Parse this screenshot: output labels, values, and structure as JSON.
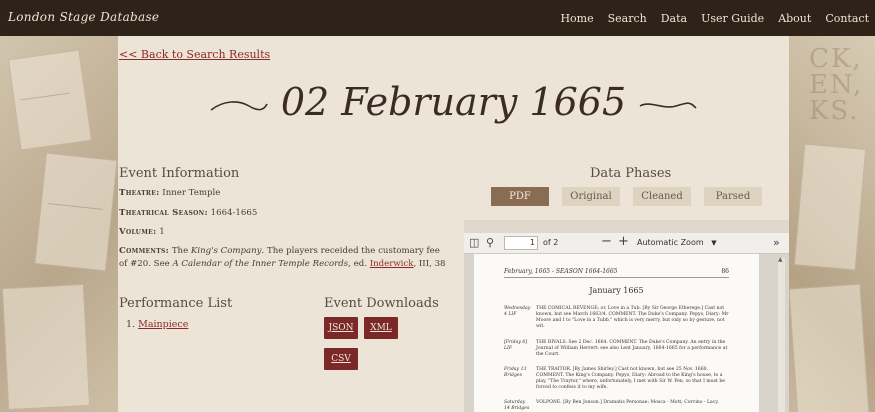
{
  "brand": "London Stage Database",
  "nav": [
    "Home",
    "Search",
    "Data",
    "User Guide",
    "About",
    "Contact"
  ],
  "back_link": "<< Back to Search Results",
  "date_title": "02 February 1665",
  "event_info": {
    "heading": "Event Information",
    "theatre_label": "Theatre:",
    "theatre": "Inner Temple",
    "season_label": "Theatrical Season:",
    "season": "1664-1665",
    "volume_label": "Volume:",
    "volume": "1",
    "comments_label": "Comments:",
    "comments_pre": "The",
    "comments_company": "King's Company",
    "comments_mid": ". The players receided the customary fee of #20. See",
    "comments_source": "A Calendar of the Inner Temple Records",
    "comments_ed": ", ed.",
    "comments_link": "Inderwick",
    "comments_post": ", III, 38"
  },
  "performance": {
    "heading": "Performance List",
    "items": [
      {
        "num": "1.",
        "label": "Mainpiece"
      }
    ]
  },
  "downloads": {
    "heading": "Event Downloads",
    "json": "JSON",
    "xml": "XML",
    "csv": "CSV"
  },
  "data_phases": {
    "heading": "Data Phases",
    "tabs": [
      "PDF",
      "Original",
      "Cleaned",
      "Parsed"
    ],
    "active": "PDF"
  },
  "pdf_viewer": {
    "page": "1",
    "of": "of 2",
    "zoom": "Automatic Zoom",
    "page_header": "February, 1665 - SEASON 1664-1665",
    "page_number": "86",
    "month_heading": "January 1665",
    "entries": [
      {
        "date": "Wednesday 4 LIF",
        "text": "THE COMICAL REVENGE; or, Love in a Tub. [By Sir George Etherege.] Cast not known, but see March 1663/4. COMMENT. The Duke's Company. Pepys, Diary: Mr Moore and I to \"Love in a Tubb,\" which is very merry, but only so by gesture, not wit."
      },
      {
        "date": "[Friday 6] LIF",
        "text": "THE RIVALS. See 2 Dec. 1664. COMMENT. The Duke's Company. An entry in the Journal of William Herrert: see also Lent January, 1664-1665 for a performance at the Court."
      },
      {
        "date": "Friday 13 Bridges",
        "text": "THE TRAITOR. [By James Shirley.] Cast not known, but see 25 Nov. 1660. COMMENT. The King's Company. Pepys, Diary: Abroad to the King's house, to a play, \"The Traytor,\" where, unfortunately, I met with Sir W. Pen, so that I must be forced to confess it to my wife."
      },
      {
        "date": "Saturday 14 Bridges",
        "text": "VOLPONE. [By Ben Jonson.] Dramatis Personae: Mosca - Mott; Corvino - Lacy."
      }
    ]
  },
  "colors": {
    "navbar": "#2f2219",
    "accent": "#7a2828",
    "link": "#8c2a2a",
    "tab_active": "#8a6c55",
    "background": "#ece4d6"
  }
}
